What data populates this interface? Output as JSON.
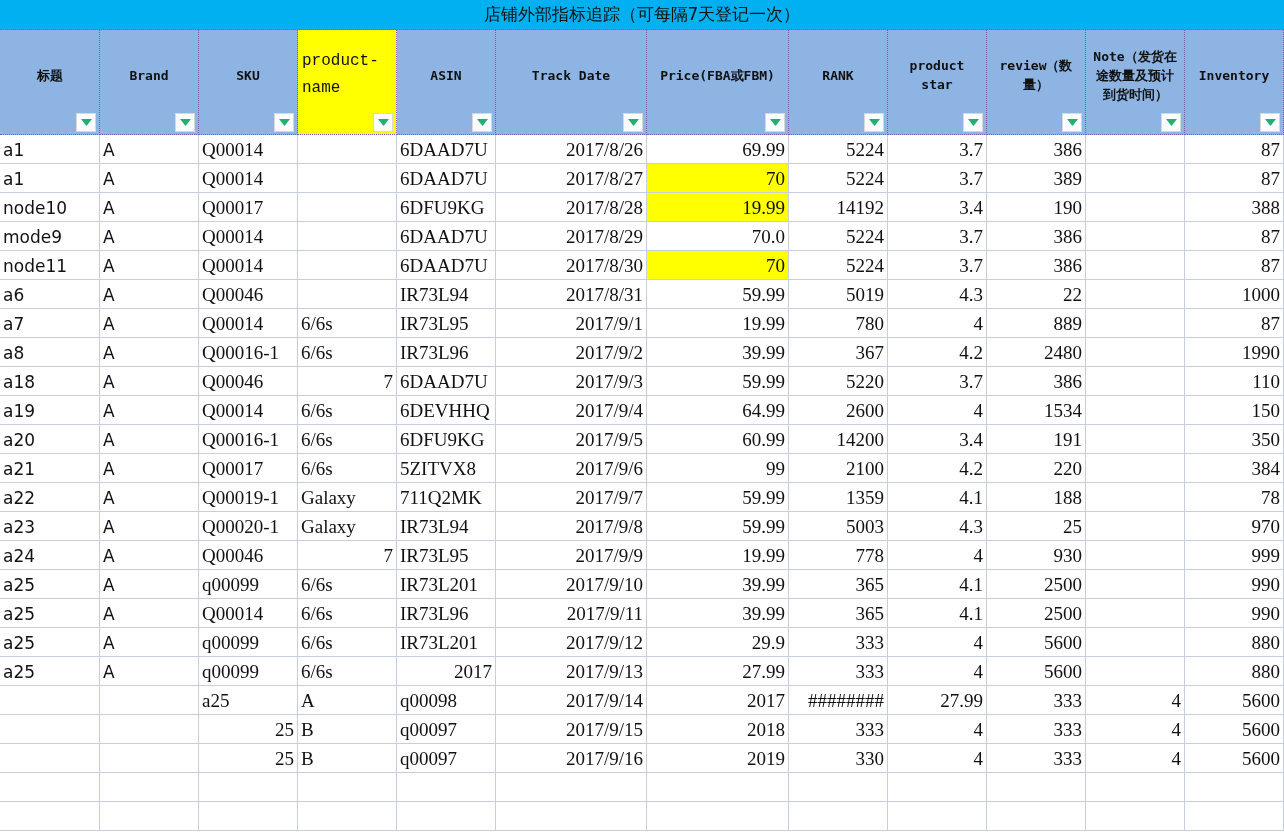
{
  "title": "店铺外部指标追踪（可每隔7天登记一次）",
  "columns": [
    {
      "label": "标题",
      "highlighted": false
    },
    {
      "label": "Brand",
      "highlighted": false
    },
    {
      "label": "SKU",
      "highlighted": false
    },
    {
      "label": "product-name",
      "highlighted": true
    },
    {
      "label": "ASIN",
      "highlighted": false
    },
    {
      "label": "Track Date",
      "highlighted": false
    },
    {
      "label": "Price(FBA或FBM)",
      "highlighted": false
    },
    {
      "label": "RANK",
      "highlighted": false
    },
    {
      "label": "product star",
      "highlighted": false
    },
    {
      "label": "review（数量）",
      "highlighted": false
    },
    {
      "label": "Note（发货在途数量及预计到货时间）",
      "highlighted": false
    },
    {
      "label": "Inventory",
      "highlighted": false
    }
  ],
  "rows": [
    [
      "a1",
      "A",
      "Q00014",
      null,
      "6DAAD7U",
      {
        "num": "2017/8/26"
      },
      {
        "num": "69.99"
      },
      {
        "num": "5224"
      },
      {
        "num": "3.7"
      },
      {
        "num": "386"
      },
      null,
      {
        "num": "87"
      }
    ],
    [
      "a1",
      "A",
      "Q00014",
      null,
      "6DAAD7U",
      {
        "num": "2017/8/27"
      },
      {
        "num": "70",
        "highlighted": true
      },
      {
        "num": "5224"
      },
      {
        "num": "3.7"
      },
      {
        "num": "389"
      },
      null,
      {
        "num": "87"
      }
    ],
    [
      "node10",
      "A",
      "Q00017",
      null,
      "6DFU9KG",
      {
        "num": "2017/8/28"
      },
      {
        "num": "19.99",
        "highlighted": true
      },
      {
        "num": "14192"
      },
      {
        "num": "3.4"
      },
      {
        "num": "190"
      },
      null,
      {
        "num": "388"
      }
    ],
    [
      "mode9",
      "A",
      "Q00014",
      null,
      "6DAAD7U",
      {
        "num": "2017/8/29"
      },
      {
        "num": "70.0"
      },
      {
        "num": "5224"
      },
      {
        "num": "3.7"
      },
      {
        "num": "386"
      },
      null,
      {
        "num": "87"
      }
    ],
    [
      "node11",
      "A",
      "Q00014",
      null,
      "6DAAD7U",
      {
        "num": "2017/8/30"
      },
      {
        "num": "70",
        "highlighted": true
      },
      {
        "num": "5224"
      },
      {
        "num": "3.7"
      },
      {
        "num": "386"
      },
      null,
      {
        "num": "87"
      }
    ],
    [
      "a6",
      "A",
      "Q00046",
      null,
      "IR73L94",
      {
        "num": "2017/8/31"
      },
      {
        "num": "59.99"
      },
      {
        "num": "5019"
      },
      {
        "num": "4.3"
      },
      {
        "num": "22"
      },
      null,
      {
        "num": "1000"
      }
    ],
    [
      "a7",
      "A",
      "Q00014",
      "6/6s",
      "IR73L95",
      {
        "num": "2017/9/1"
      },
      {
        "num": "19.99"
      },
      {
        "num": "780"
      },
      {
        "num": "4"
      },
      {
        "num": "889"
      },
      null,
      {
        "num": "87"
      }
    ],
    [
      "a8",
      "A",
      "Q00016-1",
      "6/6s",
      "IR73L96",
      {
        "num": "2017/9/2"
      },
      {
        "num": "39.99"
      },
      {
        "num": "367"
      },
      {
        "num": "4.2"
      },
      {
        "num": "2480"
      },
      null,
      {
        "num": "1990"
      }
    ],
    [
      "a18",
      "A",
      "Q00046",
      {
        "num": "7"
      },
      "6DAAD7U",
      {
        "num": "2017/9/3"
      },
      {
        "num": "59.99"
      },
      {
        "num": "5220"
      },
      {
        "num": "3.7"
      },
      {
        "num": "386"
      },
      null,
      {
        "num": "110"
      }
    ],
    [
      "a19",
      "A",
      "Q00014",
      "6/6s",
      "6DEVHHQ",
      {
        "num": "2017/9/4"
      },
      {
        "num": "64.99"
      },
      {
        "num": "2600"
      },
      {
        "num": "4"
      },
      {
        "num": "1534"
      },
      null,
      {
        "num": "150"
      }
    ],
    [
      "a20",
      "A",
      "Q00016-1",
      "6/6s",
      "6DFU9KG",
      {
        "num": "2017/9/5"
      },
      {
        "num": "60.99"
      },
      {
        "num": "14200"
      },
      {
        "num": "3.4"
      },
      {
        "num": "191"
      },
      null,
      {
        "num": "350"
      }
    ],
    [
      "a21",
      "A",
      "Q00017",
      "6/6s",
      "5ZITVX8",
      {
        "num": "2017/9/6"
      },
      {
        "num": "99"
      },
      {
        "num": "2100"
      },
      {
        "num": "4.2"
      },
      {
        "num": "220"
      },
      null,
      {
        "num": "384"
      }
    ],
    [
      "a22",
      "A",
      "Q00019-1",
      "Galaxy",
      "711Q2MK",
      {
        "num": "2017/9/7"
      },
      {
        "num": "59.99"
      },
      {
        "num": "1359"
      },
      {
        "num": "4.1"
      },
      {
        "num": "188"
      },
      null,
      {
        "num": "78"
      }
    ],
    [
      "a23",
      "A",
      "Q00020-1",
      "Galaxy",
      "IR73L94",
      {
        "num": "2017/9/8"
      },
      {
        "num": "59.99"
      },
      {
        "num": "5003"
      },
      {
        "num": "4.3"
      },
      {
        "num": "25"
      },
      null,
      {
        "num": "970"
      }
    ],
    [
      "a24",
      "A",
      "Q00046",
      {
        "num": "7"
      },
      "IR73L95",
      {
        "num": "2017/9/9"
      },
      {
        "num": "19.99"
      },
      {
        "num": "778"
      },
      {
        "num": "4"
      },
      {
        "num": "930"
      },
      null,
      {
        "num": "999"
      }
    ],
    [
      "a25",
      "A",
      "q00099",
      "6/6s",
      "IR73L201",
      {
        "num": "2017/9/10"
      },
      {
        "num": "39.99"
      },
      {
        "num": "365"
      },
      {
        "num": "4.1"
      },
      {
        "num": "2500"
      },
      null,
      {
        "num": "990"
      }
    ],
    [
      "a25",
      "A",
      "Q00014",
      "6/6s",
      "IR73L96",
      {
        "num": "2017/9/11"
      },
      {
        "num": "39.99"
      },
      {
        "num": "365"
      },
      {
        "num": "4.1"
      },
      {
        "num": "2500"
      },
      null,
      {
        "num": "990"
      }
    ],
    [
      "a25",
      "A",
      "q00099",
      "6/6s",
      "IR73L201",
      {
        "num": "2017/9/12"
      },
      {
        "num": "29.9"
      },
      {
        "num": "333"
      },
      {
        "num": "4"
      },
      {
        "num": "5600"
      },
      null,
      {
        "num": "880"
      }
    ],
    [
      "a25",
      "A",
      "q00099",
      "6/6s",
      {
        "num": "2017"
      },
      {
        "num": "2017/9/13"
      },
      {
        "num": "27.99"
      },
      {
        "num": "333"
      },
      {
        "num": "4"
      },
      {
        "num": "5600"
      },
      null,
      {
        "num": "880"
      }
    ],
    [
      null,
      null,
      "a25",
      "A",
      "q00098",
      {
        "num": "2017/9/14"
      },
      {
        "num": "2017"
      },
      {
        "num": "########"
      },
      {
        "num": "27.99"
      },
      {
        "num": "333"
      },
      {
        "num": "4"
      },
      {
        "num": "5600"
      }
    ],
    [
      null,
      null,
      {
        "num": "25"
      },
      "B",
      "q00097",
      {
        "num": "2017/9/15"
      },
      {
        "num": "2018"
      },
      {
        "num": "333"
      },
      {
        "num": "4"
      },
      {
        "num": "333"
      },
      {
        "num": "4"
      },
      {
        "num": "5600"
      }
    ],
    [
      null,
      null,
      {
        "num": "25"
      },
      "B",
      "q00097",
      {
        "num": "2017/9/16"
      },
      {
        "num": "2019"
      },
      {
        "num": "330"
      },
      {
        "num": "4"
      },
      {
        "num": "333"
      },
      {
        "num": "4"
      },
      {
        "num": "5600"
      }
    ]
  ]
}
